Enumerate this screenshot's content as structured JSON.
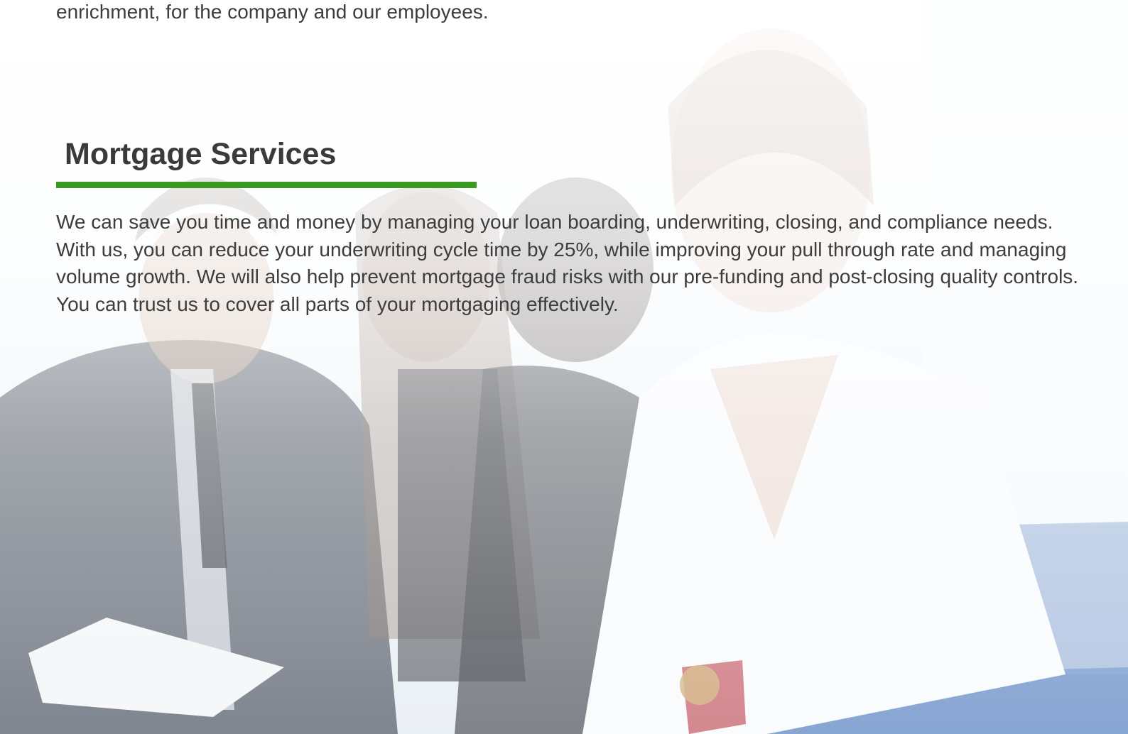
{
  "intro": {
    "text": "enrichment, for the company and our employees."
  },
  "section": {
    "title": "Mortgage Services",
    "accent_color": "#3a9a22",
    "body": "We can save you time and money by managing your loan boarding, underwriting, closing, and compliance needs. With us, you can reduce your underwriting cycle time by 25%, while improving your pull through rate and managing volume growth. We will also help prevent mortgage fraud risks with our pre-funding and post-closing quality controls. You can trust us to cover all parts of your mortgaging effectively."
  },
  "background": {
    "image_description_icon": "office-team-photo-icon"
  }
}
